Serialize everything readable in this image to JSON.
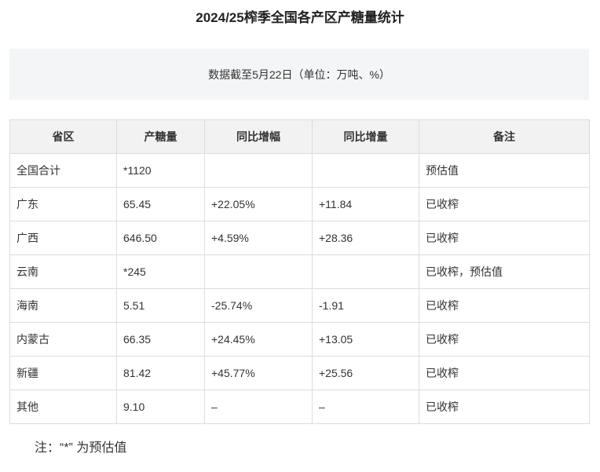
{
  "title": "2024/25榨季全国各产区产糖量统计",
  "note": "数据截至5月22日（单位：万吨、%）",
  "table": {
    "headers": [
      "省区",
      "产糖量",
      "同比增幅",
      "同比增量",
      "备注"
    ],
    "rows": [
      [
        "全国合计",
        "*1120",
        "",
        "",
        "预估值"
      ],
      [
        "广东",
        "65.45",
        "+22.05%",
        "+11.84",
        "已收榨"
      ],
      [
        "广西",
        "646.50",
        "+4.59%",
        "+28.36",
        "已收榨"
      ],
      [
        "云南",
        "*245",
        "",
        "",
        "已收榨，预估值"
      ],
      [
        "海南",
        "5.51",
        "-25.74%",
        "-1.91",
        "已收榨"
      ],
      [
        "内蒙古",
        "66.35",
        "+24.45%",
        "+13.05",
        "已收榨"
      ],
      [
        "新疆",
        "81.42",
        "+45.77%",
        "+25.56",
        "已收榨"
      ],
      [
        "其他",
        "9.10",
        "–",
        "–",
        "已收榨"
      ]
    ]
  },
  "footnote": "注：“*” 为预估值"
}
